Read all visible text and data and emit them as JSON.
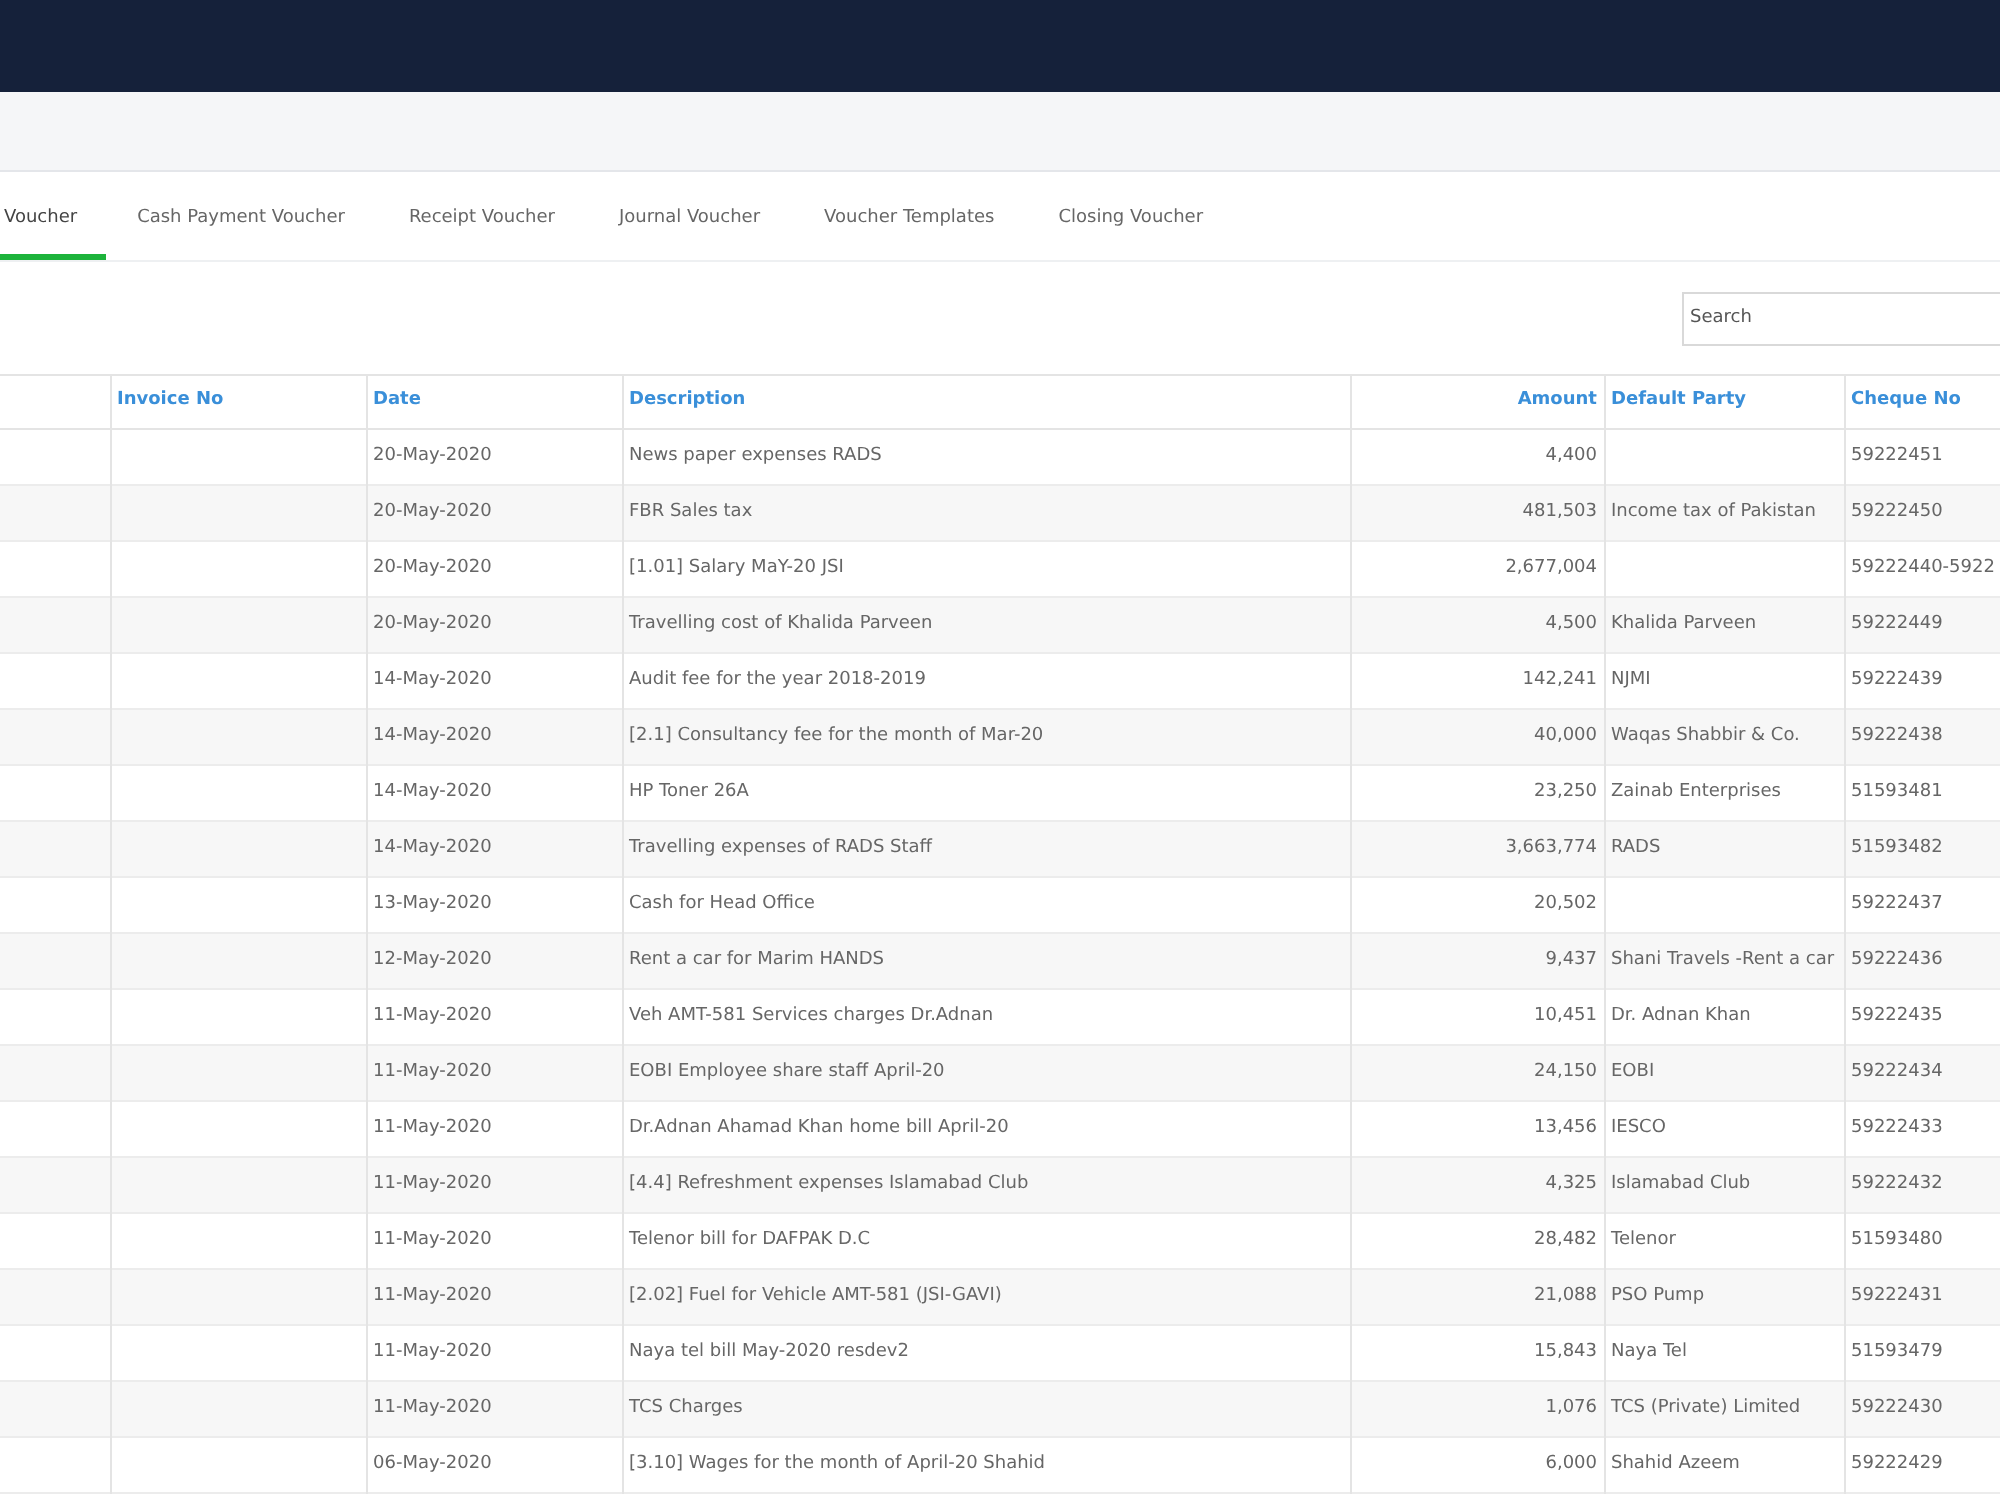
{
  "tabs": [
    {
      "label": "Voucher",
      "selected": true
    },
    {
      "label": "Cash Payment Voucher",
      "selected": false
    },
    {
      "label": "Receipt Voucher",
      "selected": false
    },
    {
      "label": "Journal Voucher",
      "selected": false
    },
    {
      "label": "Voucher Templates",
      "selected": false
    },
    {
      "label": "Closing Voucher",
      "selected": false
    }
  ],
  "search": {
    "placeholder": "Search"
  },
  "table": {
    "columns": [
      "Invoice No",
      "Date",
      "Description",
      "Amount",
      "Default Party",
      "Cheque No"
    ],
    "rows": [
      {
        "date": "20-May-2020",
        "description": "News paper expenses RADS",
        "amount": "4,400",
        "party": "",
        "cheque": "59222451"
      },
      {
        "date": "20-May-2020",
        "description": "FBR Sales tax",
        "amount": "481,503",
        "party": "Income tax of Pakistan",
        "cheque": "59222450"
      },
      {
        "date": "20-May-2020",
        "description": "[1.01] Salary MaY-20 JSI",
        "amount": "2,677,004",
        "party": "",
        "cheque": "59222440-5922"
      },
      {
        "date": "20-May-2020",
        "description": "Travelling cost of Khalida Parveen",
        "amount": "4,500",
        "party": "Khalida Parveen",
        "cheque": "59222449"
      },
      {
        "date": "14-May-2020",
        "description": "Audit fee for the year 2018-2019",
        "amount": "142,241",
        "party": "NJMI",
        "cheque": "59222439"
      },
      {
        "date": "14-May-2020",
        "description": "[2.1] Consultancy fee for the month of Mar-20",
        "amount": "40,000",
        "party": "Waqas Shabbir & Co.",
        "cheque": "59222438"
      },
      {
        "date": "14-May-2020",
        "description": "HP Toner 26A",
        "amount": "23,250",
        "party": "Zainab Enterprises",
        "cheque": "51593481"
      },
      {
        "date": "14-May-2020",
        "description": "Travelling expenses of RADS Staff",
        "amount": "3,663,774",
        "party": "RADS",
        "cheque": "51593482"
      },
      {
        "date": "13-May-2020",
        "description": "Cash for Head Office",
        "amount": "20,502",
        "party": "",
        "cheque": "59222437"
      },
      {
        "date": "12-May-2020",
        "description": "Rent a car for Marim HANDS",
        "amount": "9,437",
        "party": "Shani Travels -Rent a car",
        "cheque": "59222436"
      },
      {
        "date": "11-May-2020",
        "description": "Veh AMT-581 Services charges Dr.Adnan",
        "amount": "10,451",
        "party": "Dr. Adnan Khan",
        "cheque": "59222435"
      },
      {
        "date": "11-May-2020",
        "description": "EOBI Employee share staff April-20",
        "amount": "24,150",
        "party": "EOBI",
        "cheque": "59222434"
      },
      {
        "date": "11-May-2020",
        "description": "Dr.Adnan Ahamad Khan home bill April-20",
        "amount": "13,456",
        "party": "IESCO",
        "cheque": "59222433"
      },
      {
        "date": "11-May-2020",
        "description": "[4.4] Refreshment expenses Islamabad Club",
        "amount": "4,325",
        "party": "Islamabad Club",
        "cheque": "59222432"
      },
      {
        "date": "11-May-2020",
        "description": "Telenor bill for DAFPAK D.C",
        "amount": "28,482",
        "party": "Telenor",
        "cheque": "51593480"
      },
      {
        "date": "11-May-2020",
        "description": "[2.02] Fuel for Vehicle AMT-581 (JSI-GAVI)",
        "amount": "21,088",
        "party": "PSO Pump",
        "cheque": "59222431"
      },
      {
        "date": "11-May-2020",
        "description": "Naya tel bill May-2020 resdev2",
        "amount": "15,843",
        "party": "Naya Tel",
        "cheque": "51593479"
      },
      {
        "date": "11-May-2020",
        "description": "TCS Charges",
        "amount": "1,076",
        "party": "TCS (Private) Limited",
        "cheque": "59222430"
      },
      {
        "date": "06-May-2020",
        "description": "[3.10] Wages for the month of April-20 Shahid",
        "amount": "6,000",
        "party": "Shahid Azeem",
        "cheque": "59222429"
      }
    ]
  }
}
